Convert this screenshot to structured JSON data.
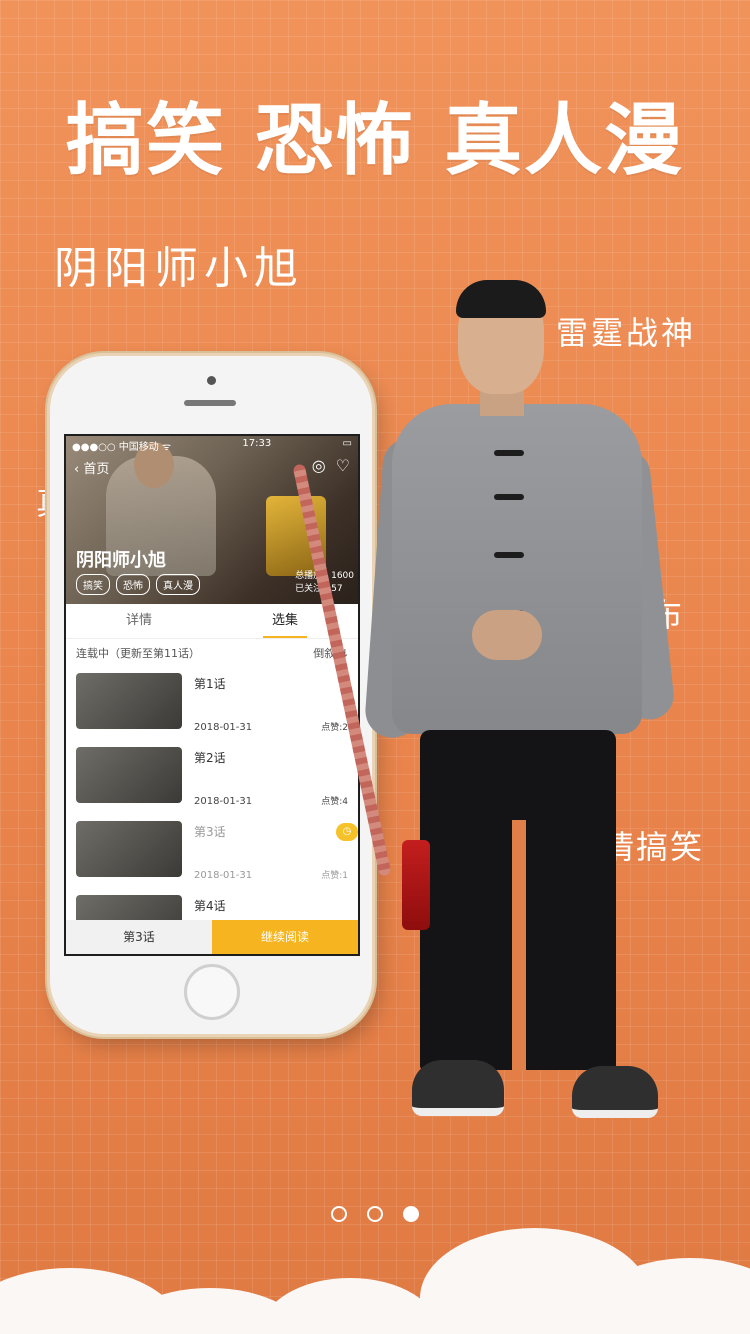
{
  "headline": "搞笑 恐怖 真人漫",
  "hand_labels": {
    "title": "阴阳师小旭",
    "right_1": "雷霆战神",
    "right_2": "布",
    "right_3": "情搞笑",
    "left_1": "真"
  },
  "phone": {
    "status": {
      "carrier": "●●●○○ 中国移动 ᯤ",
      "time": "17:33"
    },
    "back_label": "首页",
    "title": "阴阳师小旭",
    "tags": [
      "搞笑",
      "恐怖",
      "真人漫"
    ],
    "stats": {
      "plays": "总播放：1600",
      "follows": "已关注：57"
    },
    "tabs": [
      "详情",
      "选集"
    ],
    "active_tab": "选集",
    "serial_status": "连载中（更新至第11话）",
    "sort_label": "倒叙 ⇅",
    "episodes": [
      {
        "title": "第1话",
        "date": "2018-01-31",
        "likes": "点赞:2"
      },
      {
        "title": "第2话",
        "date": "2018-01-31",
        "likes": "点赞:4"
      },
      {
        "title": "第3话",
        "date": "2018-01-31",
        "likes": "点赞:1"
      },
      {
        "title": "第4话",
        "date": "",
        "likes": ""
      }
    ],
    "current_episode": "第3话",
    "continue_label": "继续阅读"
  },
  "pager": {
    "count": 3,
    "active_index": 2
  },
  "colors": {
    "background": "#ec8a51",
    "accent": "#f6b520"
  }
}
